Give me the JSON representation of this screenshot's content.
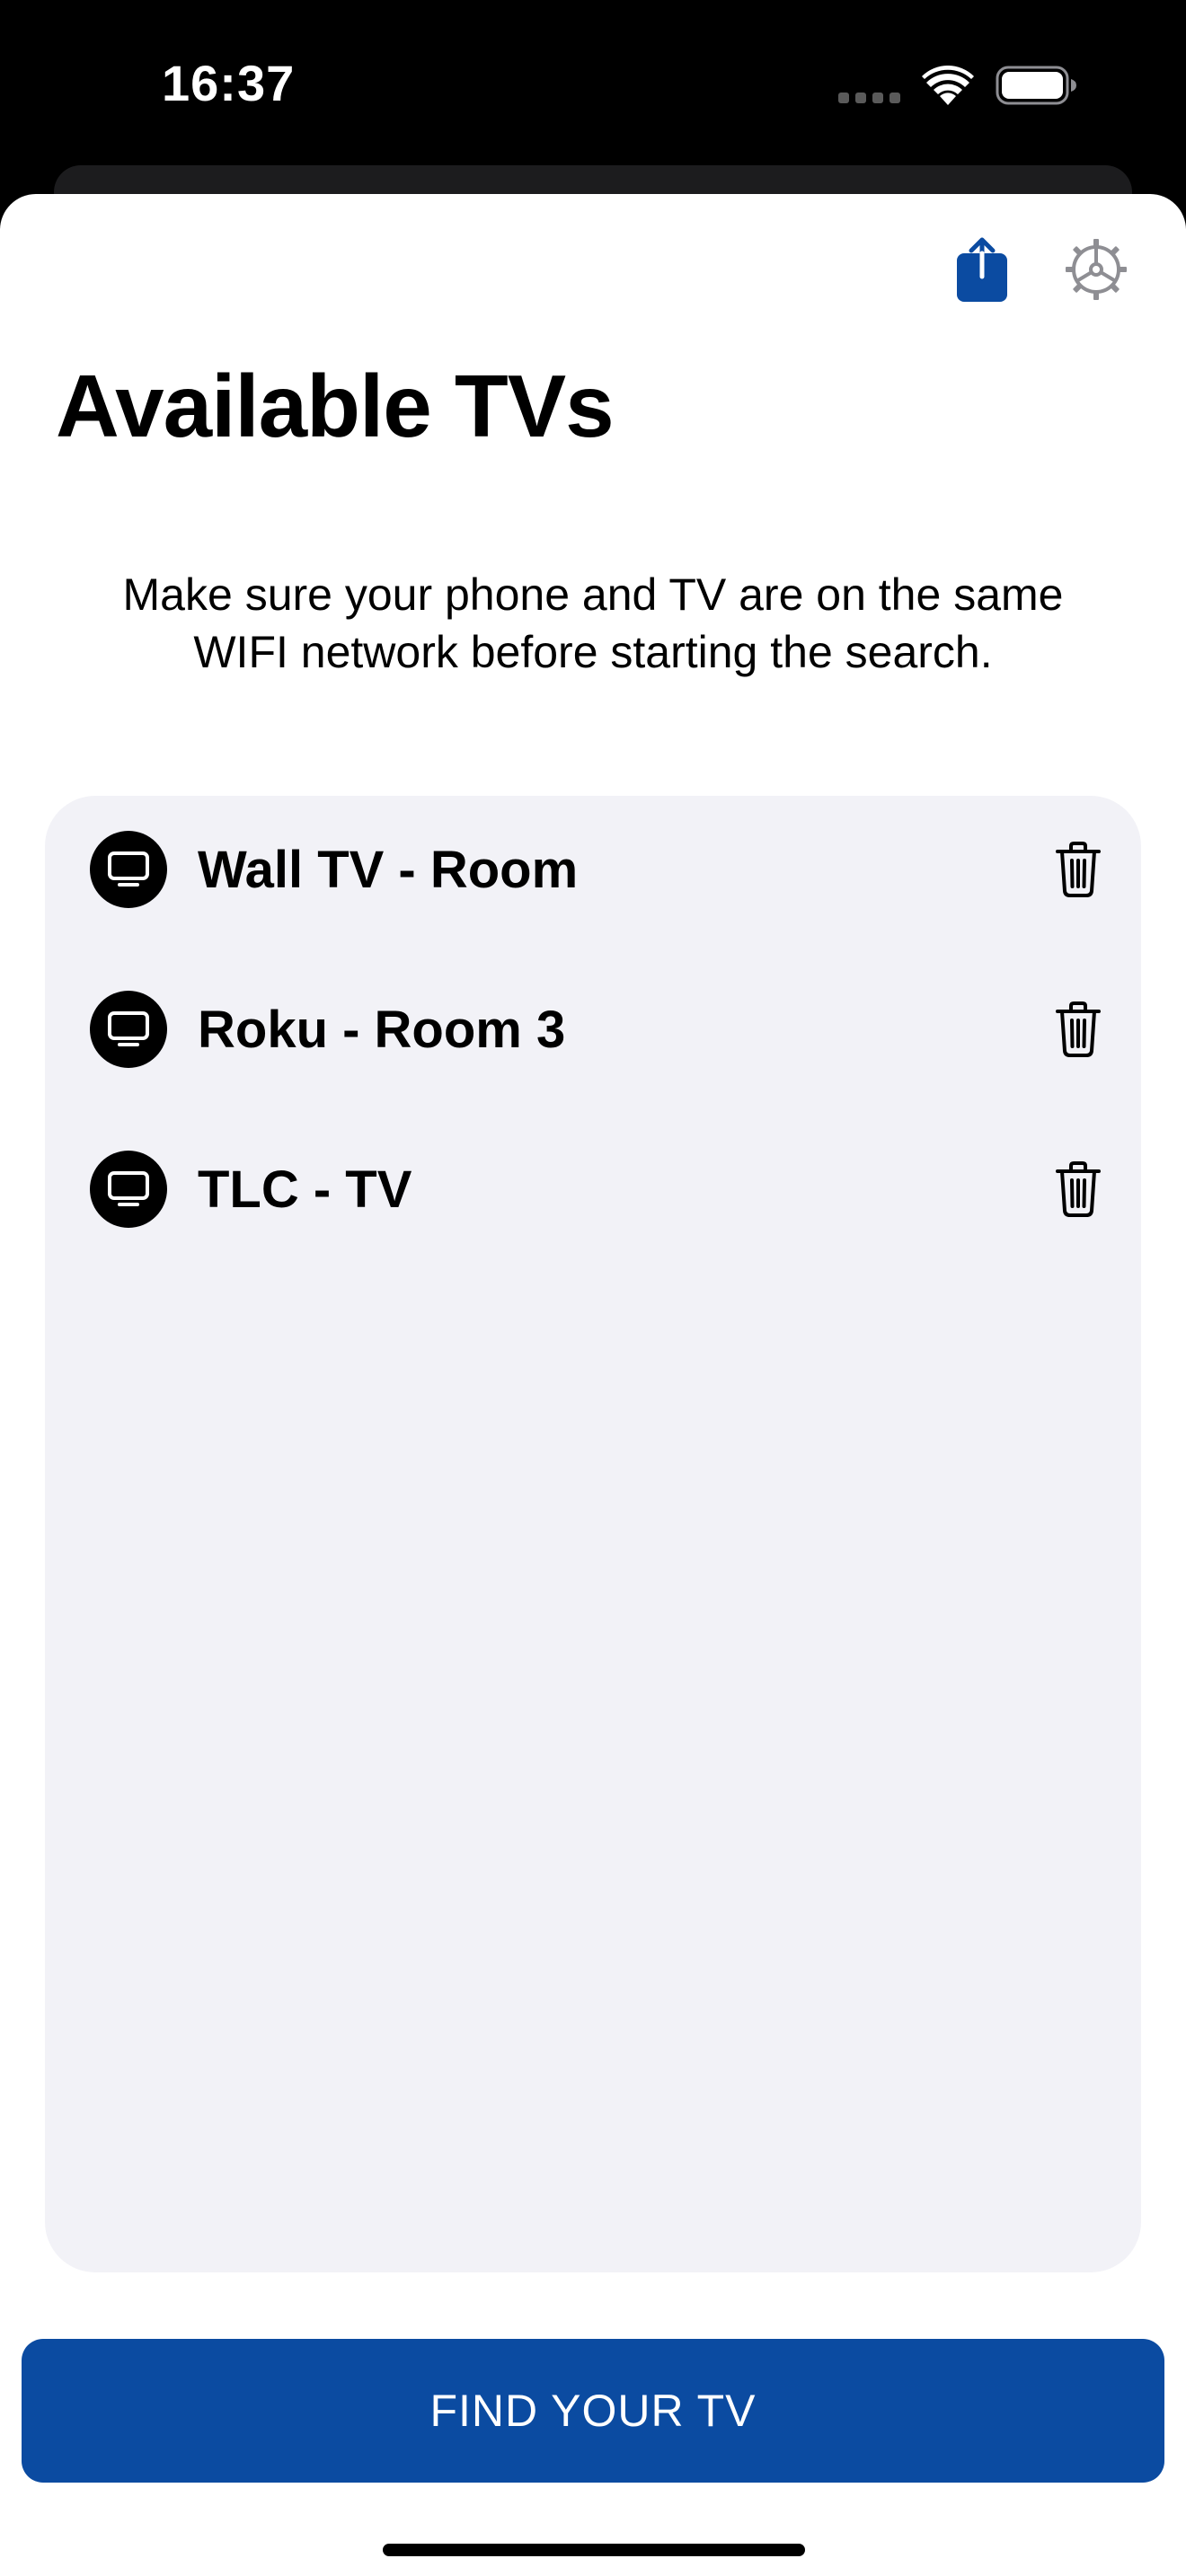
{
  "status_bar": {
    "time": "16:37",
    "icons": [
      "signal-dots-icon",
      "wifi-icon",
      "battery-icon"
    ]
  },
  "header": {
    "title": "Available TVs",
    "share_icon": "share-icon",
    "settings_icon": "gear-icon",
    "accent_color": "#0b4ba1"
  },
  "instruction": "Make sure your phone and TV are on the same WIFI network before starting the search.",
  "tv_list": {
    "items": [
      {
        "name": "Wall TV - Room",
        "icon": "tv-icon",
        "action_icon": "trash-icon"
      },
      {
        "name": "Roku - Room 3",
        "icon": "tv-icon",
        "action_icon": "trash-icon"
      },
      {
        "name": "TLC - TV",
        "icon": "tv-icon",
        "action_icon": "trash-icon"
      }
    ],
    "background_color": "#f2f2f7"
  },
  "primary_button": {
    "label": "FIND YOUR TV",
    "color": "#0b4ba1"
  }
}
